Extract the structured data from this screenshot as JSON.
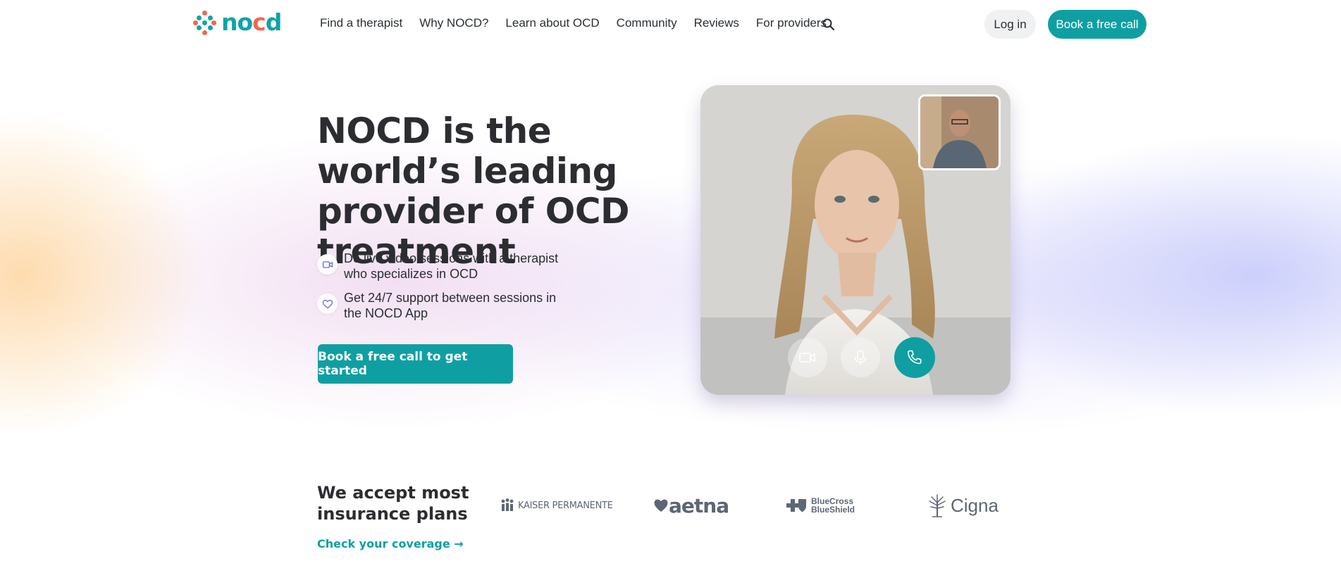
{
  "brand": {
    "name": "nocd",
    "colors": {
      "teal": "#0f9fa3",
      "coral": "#f2674f",
      "text": "#2c2d31"
    }
  },
  "nav": {
    "items": [
      "Find a therapist",
      "Why NOCD?",
      "Learn about OCD",
      "Community",
      "Reviews",
      "For providers"
    ],
    "search_icon": "search-icon",
    "login_label": "Log in",
    "book_label": "Book a free call"
  },
  "hero": {
    "title": "NOCD is the world’s leading provider of OCD treatment",
    "bullets": [
      {
        "icon": "video-camera-icon",
        "text": "Do live video sessions with a therapist who specializes in OCD"
      },
      {
        "icon": "heart-icon",
        "text": "Get 24/7 support between sessions in the NOCD App"
      }
    ],
    "cta_label": "Book a free call to get started"
  },
  "video_call": {
    "controls": [
      "camera-icon",
      "microphone-icon",
      "phone-icon"
    ]
  },
  "insurance": {
    "title": "We accept most insurance plans",
    "link_label": "Check your coverage →",
    "logos": [
      "KAISER PERMANENTE",
      "aetna",
      "BlueCross BlueShield",
      "Cigna"
    ]
  }
}
